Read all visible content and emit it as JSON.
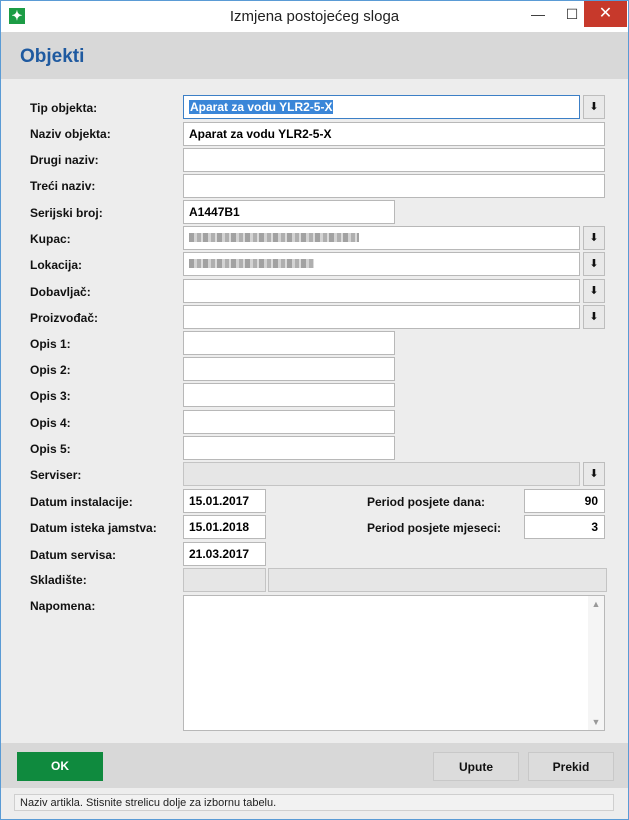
{
  "window": {
    "title": "Izmjena postojećeg sloga",
    "min_glyph": "—",
    "max_glyph": "☐",
    "close_glyph": "✕",
    "app_icon_glyph": "✦"
  },
  "page": {
    "title": "Objekti"
  },
  "dropdown_glyph": "⬇",
  "form": {
    "tip_objekta": {
      "label": "Tip objekta:",
      "value": "Aparat za vodu YLR2-5-X"
    },
    "naziv_objekta": {
      "label": "Naziv objekta:",
      "value": "Aparat za vodu YLR2-5-X"
    },
    "drugi_naziv": {
      "label": "Drugi naziv:",
      "value": ""
    },
    "treci_naziv": {
      "label": "Treći naziv:",
      "value": ""
    },
    "serijski_broj": {
      "label": "Serijski broj:",
      "value": "A1447B1"
    },
    "kupac": {
      "label": "Kupac:",
      "value": ""
    },
    "lokacija": {
      "label": "Lokacija:",
      "value": ""
    },
    "dobavljac": {
      "label": "Dobavljač:",
      "value": ""
    },
    "proizvodac": {
      "label": "Proizvođač:",
      "value": ""
    },
    "opis1": {
      "label": "Opis 1:",
      "value": ""
    },
    "opis2": {
      "label": "Opis 2:",
      "value": ""
    },
    "opis3": {
      "label": "Opis 3:",
      "value": ""
    },
    "opis4": {
      "label": "Opis 4:",
      "value": ""
    },
    "opis5": {
      "label": "Opis 5:",
      "value": ""
    },
    "serviser": {
      "label": "Serviser:",
      "value": ""
    },
    "datum_instalacije": {
      "label": "Datum instalacije:",
      "value": "15.01.2017"
    },
    "datum_isteka": {
      "label": "Datum isteka jamstva:",
      "value": "15.01.2018"
    },
    "datum_servisa": {
      "label": "Datum servisa:",
      "value": "21.03.2017"
    },
    "period_dana": {
      "label": "Period posjete dana:",
      "value": "90"
    },
    "period_mjeseci": {
      "label": "Period posjete mjeseci:",
      "value": "3"
    },
    "skladiste": {
      "label": "Skladište:",
      "value": "",
      "value2": ""
    },
    "napomena": {
      "label": "Napomena:",
      "value": ""
    }
  },
  "scroll": {
    "up": "▲",
    "down": "▼"
  },
  "buttons": {
    "ok": "OK",
    "upute": "Upute",
    "prekid": "Prekid"
  },
  "status": "Naziv artikla. Stisnite strelicu dolje za izbornu tabelu."
}
